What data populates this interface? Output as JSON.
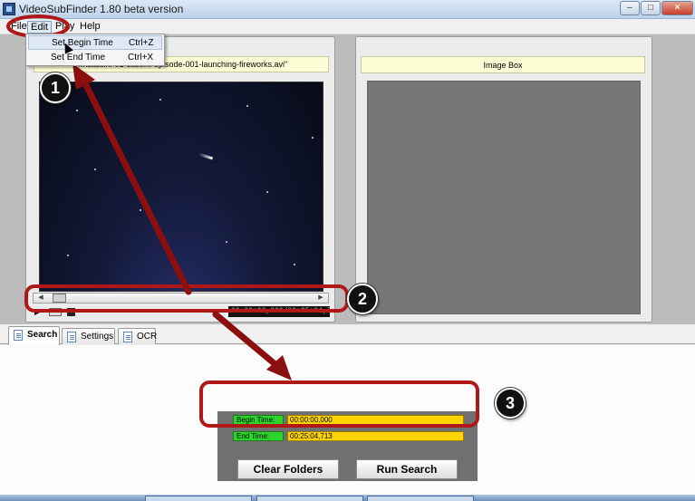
{
  "window": {
    "title": "VideoSubFinder 1.80 beta version",
    "minimize_label": "–",
    "maximize_label": "□",
    "close_label": "×"
  },
  "menu": {
    "items": [
      "File",
      "Edit",
      "Play",
      "Help"
    ]
  },
  "edit_menu": {
    "items": [
      {
        "label": "Set Begin Time",
        "shortcut": "Ctrl+Z"
      },
      {
        "label": "Set End Time",
        "shortcut": "Ctrl+X"
      }
    ]
  },
  "video_box": {
    "file_title": "\"...\\cassini-01-cassini-episode-001-launching-fireworks.avi\"",
    "time_display": "00:00:00,000/00:25:04,713"
  },
  "image_box": {
    "title": "Image Box"
  },
  "tabs": [
    {
      "label": "Search",
      "active": true
    },
    {
      "label": "Settings",
      "active": false
    },
    {
      "label": "OCR",
      "active": false
    }
  ],
  "search": {
    "begin_time_label": "Begin Time:",
    "begin_time_value": "00:00:00,000",
    "end_time_label": "End Time:",
    "end_time_value": "00:25:04,713",
    "clear_folders_label": "Clear Folders",
    "run_search_label": "Run Search"
  },
  "annotations": {
    "badge_1": "1",
    "badge_2": "2",
    "badge_3": "3",
    "color": "#b01818"
  },
  "colors": {
    "panel_header_bg": "#fefed6",
    "time_label_bg": "#2cd52c",
    "time_value_bg": "#ffd400",
    "image_canvas_bg": "#777777"
  }
}
